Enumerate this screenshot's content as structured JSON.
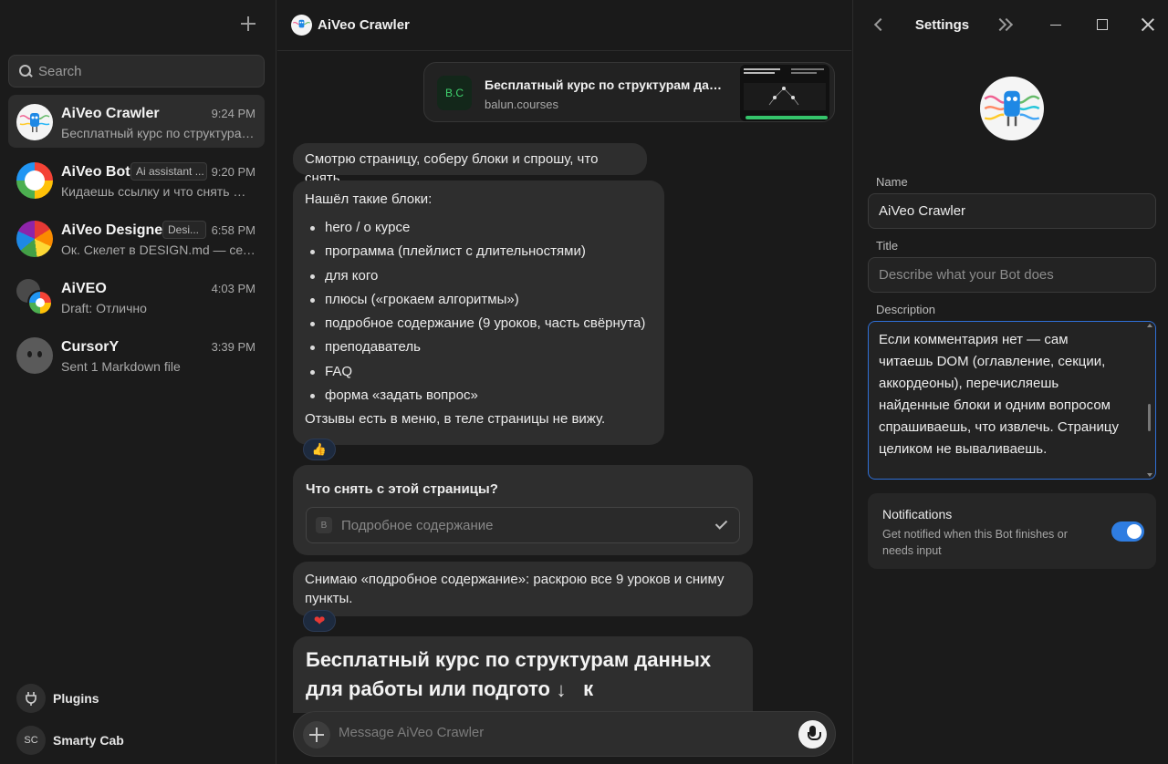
{
  "sidebar": {
    "search_placeholder": "Search",
    "chats": [
      {
        "name": "AiVeo Crawler",
        "time": "9:24 PM",
        "preview": "Бесплатный курс по структурам данных для работы или подготовки",
        "tag": "",
        "active": true,
        "avatar": "robot-avatar"
      },
      {
        "name": "AiVeo Bot",
        "time": "9:20 PM",
        "preview": "Кидаешь ссылку и что снять — получаешь данные",
        "tag": "Ai assistant ...",
        "active": false,
        "avatar": "ring-avatar"
      },
      {
        "name": "AiVeo Designer",
        "time": "6:58 PM",
        "preview": "Ок. Скелет в DESIGN.md — сетка",
        "tag": "Desi...",
        "active": false,
        "avatar": "beachball-avatar"
      },
      {
        "name": "AiVEO",
        "time": "4:03 PM",
        "preview": "Draft: Отлично",
        "tag": "",
        "active": false,
        "avatar": "group-avatar"
      },
      {
        "name": "CursorY",
        "time": "3:39 PM",
        "preview": "Sent 1 Markdown file",
        "tag": "",
        "active": false,
        "avatar": "ghost-avatar"
      }
    ],
    "plugins_label": "Plugins",
    "user_initials": "SC",
    "user_name": "Smarty Cab"
  },
  "chat": {
    "title": "AiVeo Crawler",
    "link_card": {
      "favicon": "B.C",
      "title": "Бесплатный курс по структурам данных для работы или подготовки",
      "domain": "balun.courses"
    },
    "msg1": "Смотрю страницу, соберу блоки и спрошу, что снять.",
    "msg2": {
      "intro": "Нашёл такие блоки:",
      "items": [
        "hero / о курсе",
        "программа (плейлист с длительностями)",
        "для кого",
        "плюсы («грокаем алгоритмы»)",
        "подробное содержание (9 уроков, часть свёрнута)",
        "преподаватель",
        "FAQ",
        "форма «задать вопрос»"
      ],
      "outro": "Отзывы есть в меню, в теле страницы не вижу.",
      "reaction": "👍"
    },
    "question": {
      "title": "Что снять с этой страницы?",
      "badge": "B",
      "value": "Подробное содержание"
    },
    "msg3": {
      "text": "Снимаю «подробное содержание»: раскрою все 9 уроков и сниму пункты.",
      "reaction": "❤"
    },
    "result_heading": "Бесплатный курс по структурам данных для работы или подгото",
    "result_heading_tail": "к",
    "scroll_down_icon": "↓",
    "composer_placeholder": "Message AiVeo Crawler"
  },
  "settings": {
    "title": "Settings",
    "name_label": "Name",
    "name_value": "AiVeo Crawler",
    "title_label": "Title",
    "title_placeholder": "Describe what your Bot does",
    "description_label": "Description",
    "description_value": "Если комментария нет — сам читаешь DOM (оглавление, секции, аккордеоны), перечисляешь найденные блоки и одним вопросом спрашиваешь, что извлечь. Страницу целиком не вываливаешь.",
    "notifications_title": "Notifications",
    "notifications_desc": "Get notified when this Bot finishes or needs input",
    "notifications_on": true
  },
  "colors": {
    "accent": "#2f7de1",
    "bubble": "#2e2e2e",
    "background": "#1a1a1a"
  }
}
